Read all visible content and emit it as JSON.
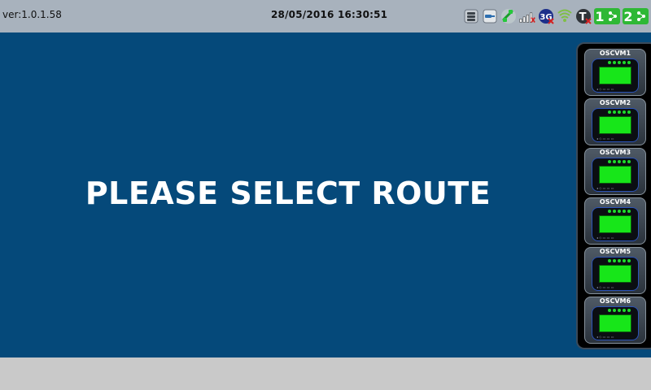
{
  "topbar": {
    "version": "ver:1.0.1.58",
    "datetime": "28/05/2016 16:30:51",
    "icons": [
      {
        "name": "database-icon"
      },
      {
        "name": "connector-icon"
      },
      {
        "name": "satellite-icon"
      },
      {
        "name": "signal-bars-icon"
      },
      {
        "name": "3g-icon",
        "text": "3G"
      },
      {
        "name": "wifi-icon"
      },
      {
        "name": "t-status-icon",
        "text": "T"
      },
      {
        "name": "route-1-icon",
        "text": "1"
      },
      {
        "name": "route-2-icon",
        "text": "2"
      }
    ]
  },
  "main": {
    "prompt": "PLEASE SELECT ROUTE"
  },
  "side_panel": {
    "devices": [
      {
        "label": "OSCVM1"
      },
      {
        "label": "OSCVM2"
      },
      {
        "label": "OSCVM3"
      },
      {
        "label": "OSCVM4"
      },
      {
        "label": "OSCVM5"
      },
      {
        "label": "OSCVM6"
      }
    ]
  }
}
